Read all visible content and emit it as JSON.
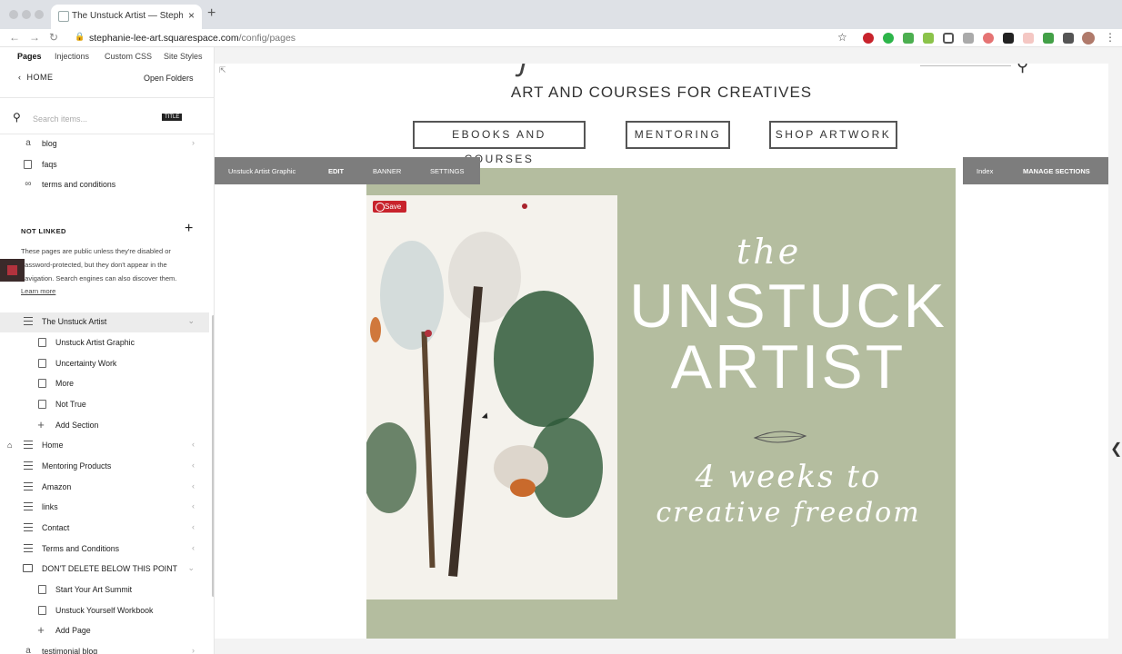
{
  "browser": {
    "tab_title": "The Unstuck Artist — Stephanie Lee",
    "url_host": "stephanie-lee-art.squarespace.com",
    "url_path": "/config/pages",
    "tab_close": "×",
    "new_tab": "+"
  },
  "panel": {
    "tabs": [
      "Pages",
      "Injections",
      "Custom CSS",
      "Site Styles",
      "+"
    ],
    "home_link": "HOME",
    "open_folders": "Open Folders",
    "search_placeholder": "Search items...",
    "search_badge": "TITLE",
    "top_items": [
      {
        "label": "blog",
        "icon": "blog-icon"
      },
      {
        "label": "faqs",
        "icon": "page-icon"
      },
      {
        "label": "terms and conditions",
        "icon": "link-icon"
      }
    ],
    "not_linked": {
      "heading": "NOT LINKED",
      "text": "These pages are public unless they're disabled or password-protected, but they don't appear in the navigation. Search engines can also discover them.",
      "learn_more": "Learn more"
    },
    "unstuck": {
      "label": "The Unstuck Artist",
      "children": [
        "Unstuck Artist Graphic",
        "Uncertainty Work",
        "More",
        "Not True"
      ],
      "add_section": "Add Section"
    },
    "collections": [
      "Home",
      "Mentoring Products",
      "Amazon",
      "links",
      "Contact",
      "Terms and Conditions"
    ],
    "folder": {
      "label": "DON'T DELETE BELOW THIS POINT",
      "children": [
        "Start Your Art Summit",
        "Unstuck Yourself Workbook"
      ],
      "add_page": "Add Page"
    },
    "last_item": "testimonial blog"
  },
  "site": {
    "tagline": "ART AND COURSES FOR CREATIVES",
    "nav": [
      "EBOOKS AND COURSES",
      "MENTORING",
      "SHOP ARTWORK"
    ],
    "editbar": {
      "name": "Unstuck Artist Graphic",
      "edit": "EDIT",
      "banner": "BANNER",
      "settings": "SETTINGS"
    },
    "indexbar": {
      "index": "Index",
      "manage": "MANAGE SECTIONS"
    },
    "banner": {
      "the": "the",
      "title1": "UNSTUCK",
      "title2": "ARTIST",
      "sub1": "4 weeks to",
      "sub2": "creative freedom",
      "save": "Save"
    }
  },
  "colors": {
    "banner_bg": "#b4bd9f",
    "pinterest_red": "#c8232c",
    "editbar_grey": "#7d7d7d"
  }
}
